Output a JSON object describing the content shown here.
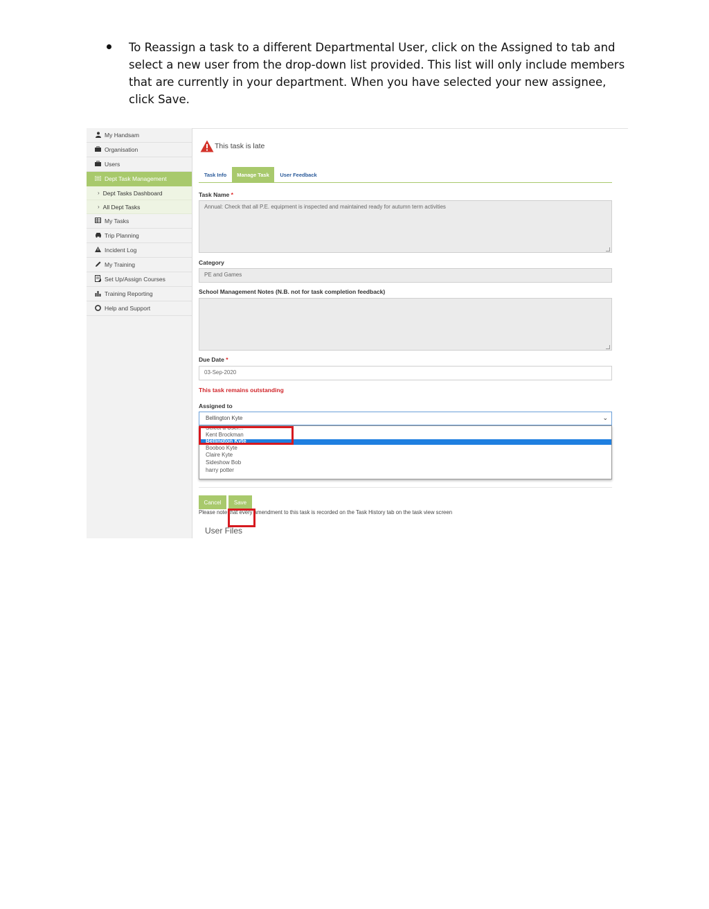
{
  "instruction": {
    "text": "To Reassign a task to a different Departmental User, click on the Assigned to tab and select a new user from the drop-down list provided. This list will only include members that are currently in your department. When you have selected your new assignee, click Save."
  },
  "sidebar": {
    "items": [
      {
        "label": "My Handsam",
        "icon": "user-icon"
      },
      {
        "label": "Organisation",
        "icon": "briefcase-icon"
      },
      {
        "label": "Users",
        "icon": "briefcase-icon"
      },
      {
        "label": "Dept Task Management",
        "icon": "list-icon",
        "active": true
      },
      {
        "label": "My Tasks",
        "icon": "table-icon"
      },
      {
        "label": "Trip Planning",
        "icon": "car-icon"
      },
      {
        "label": "Incident Log",
        "icon": "warning-icon"
      },
      {
        "label": "My Training",
        "icon": "pencil-icon"
      },
      {
        "label": "Set Up/Assign Courses",
        "icon": "document-icon"
      },
      {
        "label": "Training Reporting",
        "icon": "bar-chart-icon"
      },
      {
        "label": "Help and Support",
        "icon": "lifebuoy-icon"
      }
    ],
    "subitems": [
      {
        "label": "Dept Tasks Dashboard"
      },
      {
        "label": "All Dept Tasks"
      }
    ]
  },
  "alert": {
    "text": "This task is late"
  },
  "tabs": [
    {
      "label": "Task Info"
    },
    {
      "label": "Manage Task",
      "active": true
    },
    {
      "label": "User Feedback"
    }
  ],
  "form": {
    "task_name_label": "Task Name",
    "required_mark": "*",
    "task_name_value": "Annual: Check that all P.E. equipment is inspected and maintained ready for autumn term activities",
    "category_label": "Category",
    "category_value": "PE and Games",
    "notes_label": "School Management Notes (N.B. not for task completion feedback)",
    "notes_value": "",
    "due_date_label": "Due Date",
    "due_date_value": "03-Sep-2020",
    "outstanding_text": "This task remains outstanding",
    "assigned_label": "Assigned to",
    "assigned_value": "Bellington Kyte",
    "options": [
      "Select a User...",
      "Kent Brockman",
      "Bellington Kyte",
      "Booboo Kyte",
      "Claire Kyte",
      "Sideshow Bob",
      "harry potter"
    ],
    "selected_option": "Bellington Kyte"
  },
  "actions": {
    "cancel_label": "Cancel",
    "save_label": "Save",
    "note_text": "Please note that every amendment to this task is recorded on the Task History tab on the task view screen"
  },
  "user_files_label": "User Files",
  "colors": {
    "accent_green": "#a8c96c",
    "alert_red": "#d0262b",
    "callout_red": "#d6191f",
    "selected_blue": "#1e7fe0",
    "tab_link_blue": "#2a5a9a"
  }
}
